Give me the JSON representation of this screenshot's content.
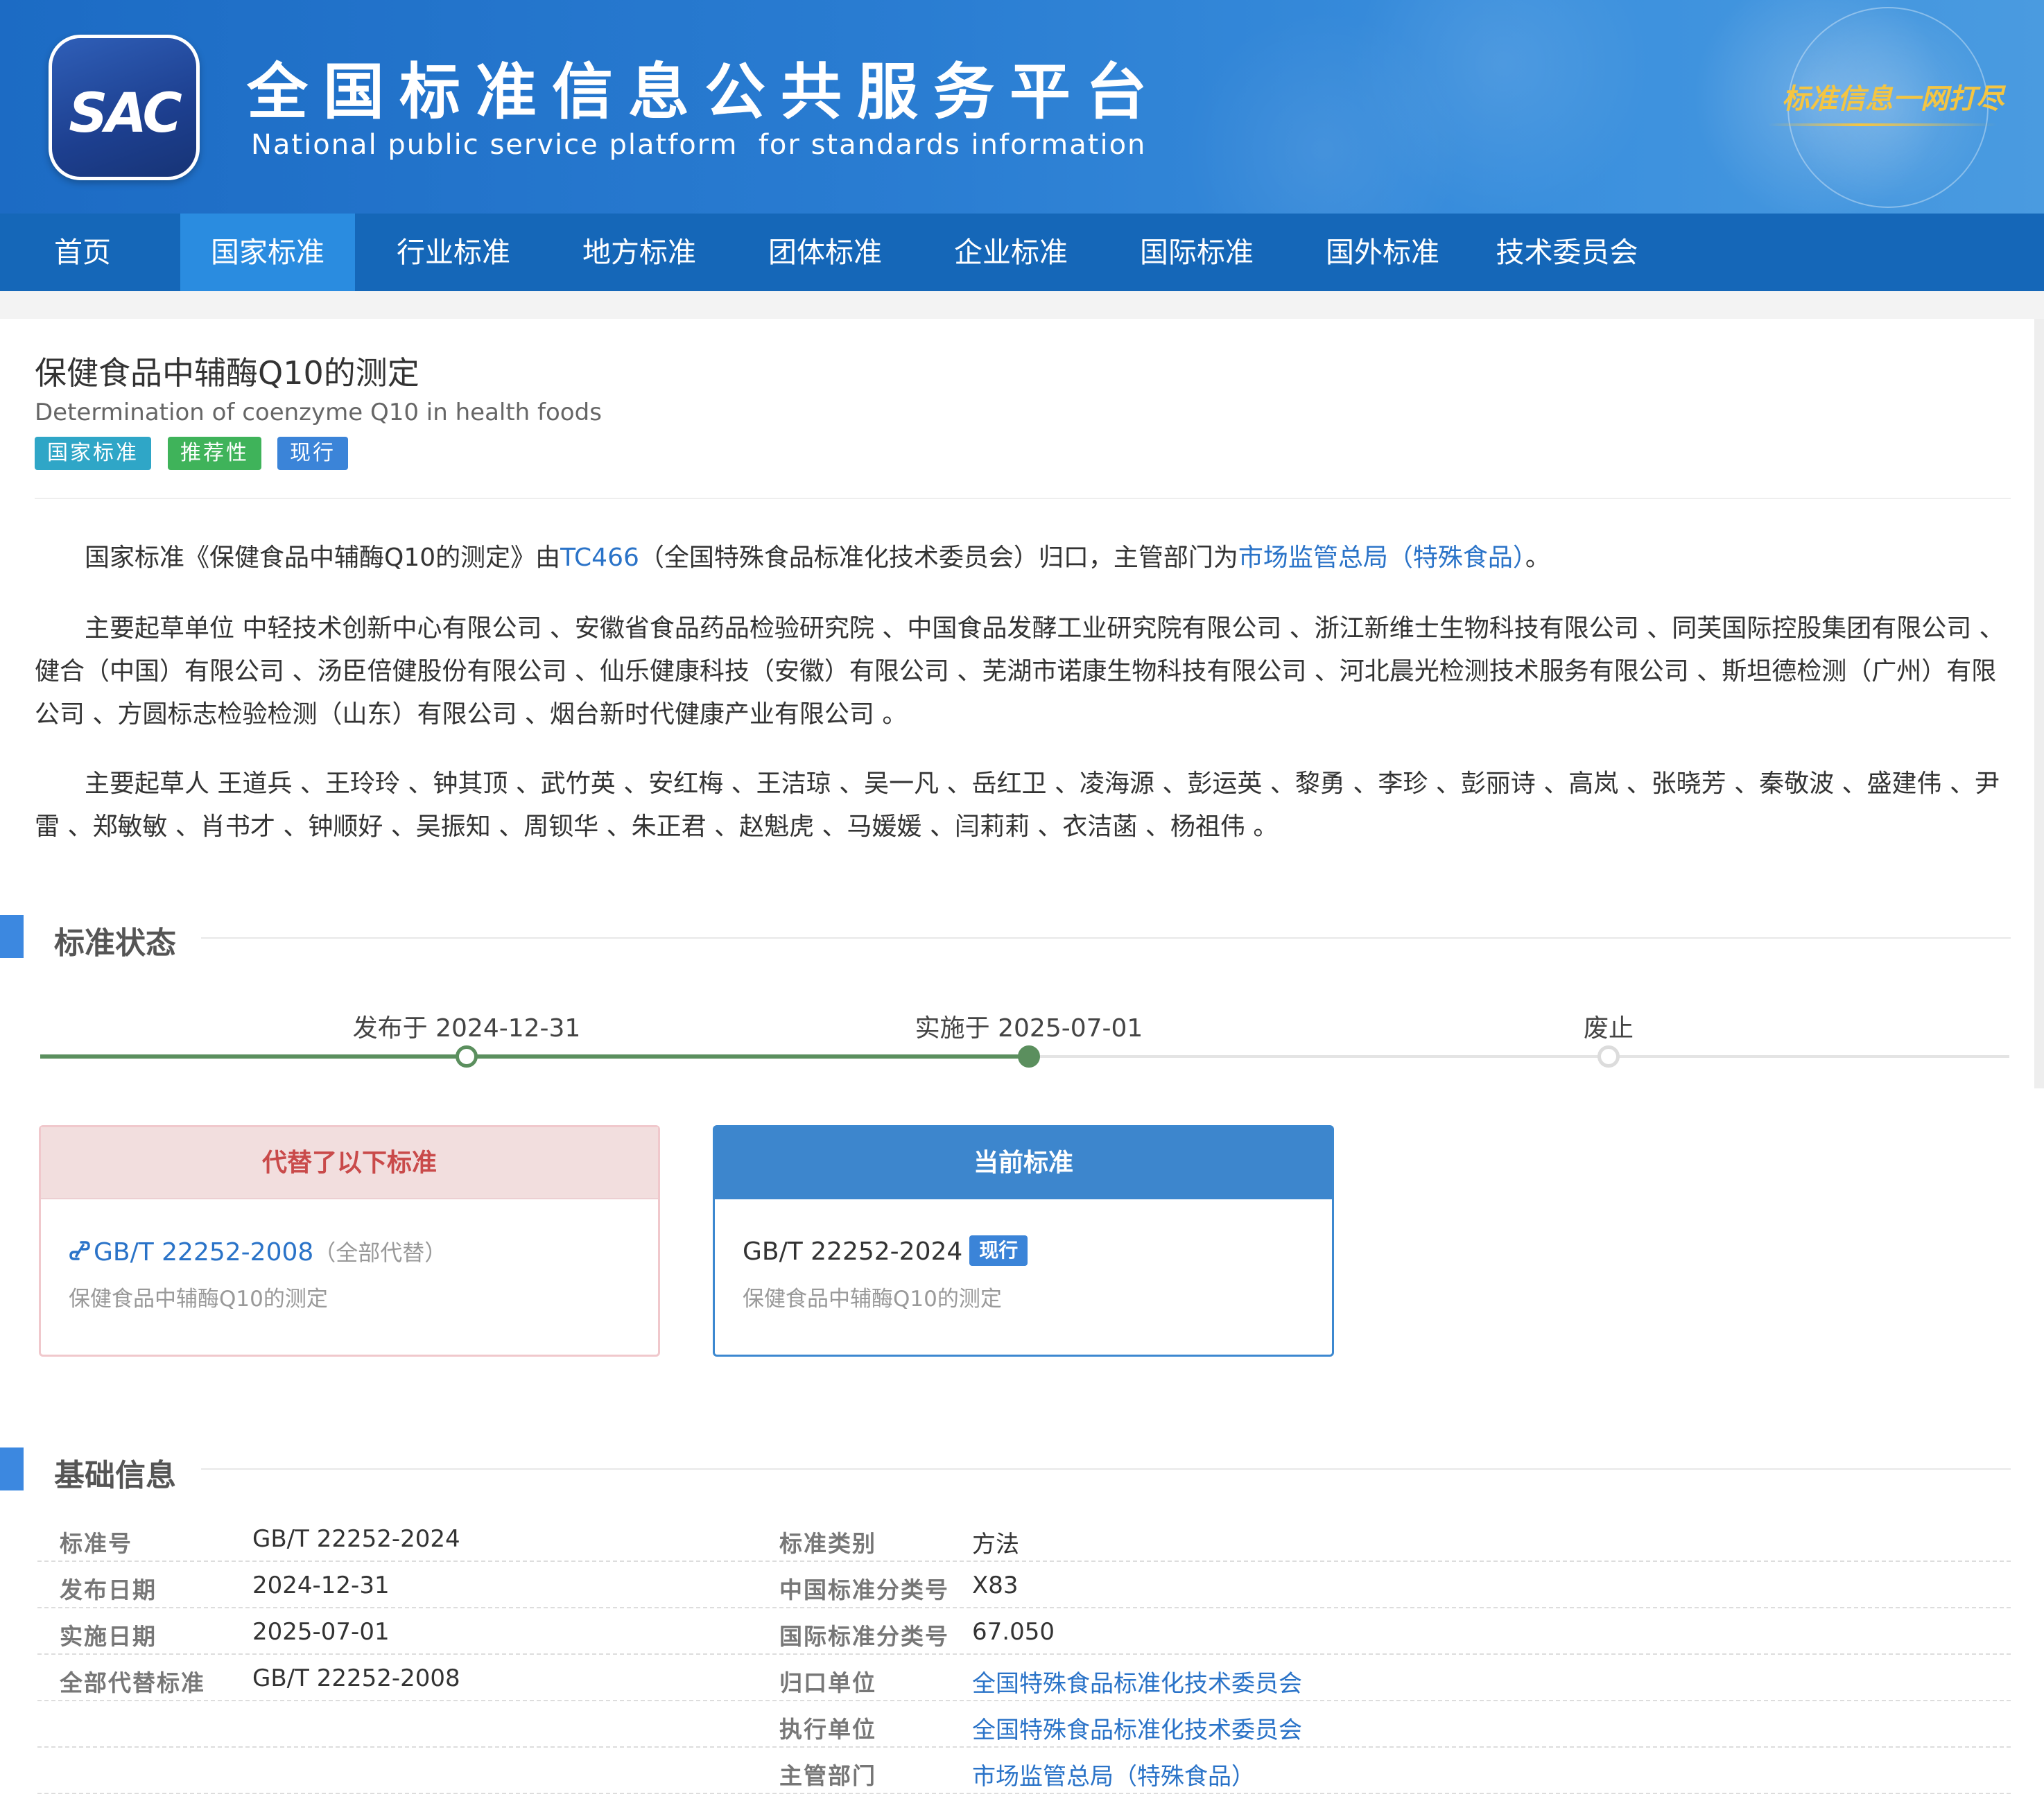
{
  "header": {
    "logo_text": "SAC",
    "title": "全国标准信息公共服务平台",
    "subtitle": "National public service platform  for standards information",
    "slogan": "标准信息一网打尽"
  },
  "nav": {
    "items": [
      {
        "label": "首页",
        "active": false
      },
      {
        "label": "国家标准",
        "active": true
      },
      {
        "label": "行业标准",
        "active": false
      },
      {
        "label": "地方标准",
        "active": false
      },
      {
        "label": "团体标准",
        "active": false
      },
      {
        "label": "企业标准",
        "active": false
      },
      {
        "label": "国际标准",
        "active": false
      },
      {
        "label": "国外标准",
        "active": false
      },
      {
        "label": "技术委员会",
        "active": false
      }
    ]
  },
  "standard": {
    "title": "保健食品中辅酶Q10的测定",
    "title_en": "Determination of coenzyme Q10 in health foods",
    "badges": [
      "国家标准",
      "推荐性",
      "现行"
    ]
  },
  "intro": {
    "prefix": "国家标准《保健食品中辅酶Q10的测定》由",
    "tc_link": "TC466",
    "tc_desc": "（全国特殊食品标准化技术委员会）归口，主管部门为",
    "dept_link": "市场监管总局（特殊食品）",
    "suffix": "。"
  },
  "drafting_units": "主要起草单位 中轻技术创新中心有限公司 、安徽省食品药品检验研究院 、中国食品发酵工业研究院有限公司 、浙江新维士生物科技有限公司 、同芙国际控股集团有限公司 、健合（中国）有限公司 、汤臣倍健股份有限公司 、仙乐健康科技（安徽）有限公司 、芜湖市诺康生物科技有限公司 、河北晨光检测技术服务有限公司 、斯坦德检测（广州）有限公司 、方圆标志检验检测（山东）有限公司 、烟台新时代健康产业有限公司 。",
  "drafters": "主要起草人 王道兵 、王玲玲 、钟其顶 、武竹英 、安红梅 、王洁琼 、吴一凡 、岳红卫 、凌海源 、彭运英 、黎勇 、李珍 、彭丽诗 、高岚 、张晓芳 、秦敬波 、盛建伟 、尹雷 、郑敏敏 、肖书才 、钟顺好 、吴振知 、周钡华 、朱正君 、赵魁虎 、马媛媛 、闫莉莉 、衣洁菡 、杨祖伟 。",
  "status_section": {
    "title": "标准状态",
    "timeline": [
      "发布于 2024-12-31",
      "实施于 2025-07-01",
      "废止"
    ],
    "replaced_card": {
      "header": "代替了以下标准",
      "code": "GB/T 22252-2008",
      "note": "（全部代替）",
      "name": "保健食品中辅酶Q10的测定"
    },
    "current_card": {
      "header": "当前标准",
      "code": "GB/T 22252-2024",
      "badge": "现行",
      "name": "保健食品中辅酶Q10的测定"
    }
  },
  "basic_info": {
    "title": "基础信息",
    "left": [
      {
        "label": "标准号",
        "value": "GB/T 22252-2024"
      },
      {
        "label": "发布日期",
        "value": "2024-12-31"
      },
      {
        "label": "实施日期",
        "value": "2025-07-01"
      },
      {
        "label": "全部代替标准",
        "value": "GB/T 22252-2008"
      }
    ],
    "right": [
      {
        "label": "标准类别",
        "value": "方法"
      },
      {
        "label": "中国标准分类号",
        "value": "X83"
      },
      {
        "label": "国际标准分类号",
        "value": "67.050"
      },
      {
        "label": "归口单位",
        "value": "全国特殊食品标准化技术委员会"
      },
      {
        "label": "执行单位",
        "value": "全国特殊食品标准化技术委员会"
      },
      {
        "label": "主管部门",
        "value": "市场监管总局（特殊食品）"
      }
    ]
  },
  "colors": {
    "header_blue": "#1c6bc4",
    "nav_blue": "#1567b8",
    "nav_active": "#2a8ce0",
    "link_blue": "#2a73c8",
    "timeline_green": "#5b8f5e",
    "badge_green": "#3fb35a",
    "replaced_red": "#c94a4a"
  }
}
